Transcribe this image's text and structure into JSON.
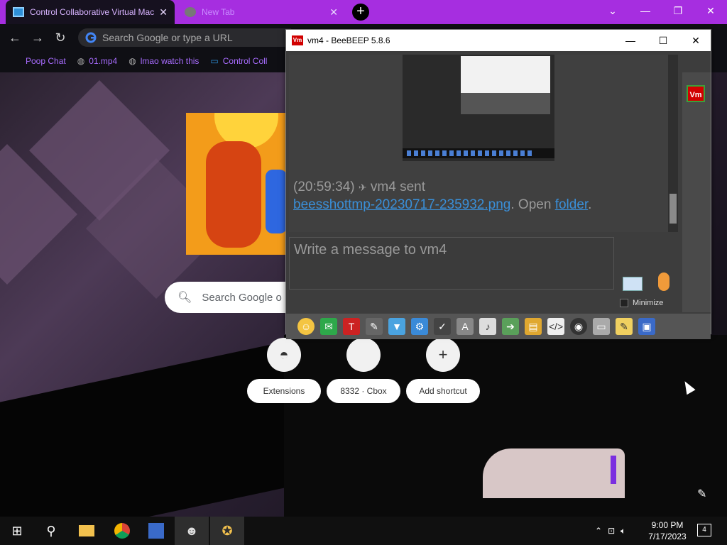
{
  "browser": {
    "tabs": [
      {
        "title": "Control Collaborative Virtual Mac",
        "active": true
      },
      {
        "title": "New Tab",
        "active": false
      }
    ],
    "omnibox_placeholder": "Search Google or type a URL",
    "bookmarks": [
      {
        "label": "Poop Chat"
      },
      {
        "label": "01.mp4"
      },
      {
        "label": "lmao watch this"
      },
      {
        "label": "Control Coll"
      }
    ],
    "accent_color": "#a62ee0"
  },
  "ntp": {
    "search_placeholder": "Search Google o",
    "shortcuts": [
      {
        "label": "Extensions"
      },
      {
        "label": "8332 · Cbox"
      },
      {
        "label": "Add shortcut"
      }
    ]
  },
  "beebeep": {
    "title": "vm4 - BeeBEEP 5.8.6",
    "badge": "Vm",
    "message_time": "(20:59:34)",
    "message_sender": "vm4 sent",
    "file_link": "beesshottmp-20230717-235932.png",
    "open_text": ". Open",
    "folder_link": "folder",
    "period": ".",
    "input_placeholder": "Write a message to vm4",
    "minimize_label": "Minimize"
  },
  "taskbar": {
    "time": "9:00 PM",
    "date": "7/17/2023",
    "notification_count": "4"
  }
}
